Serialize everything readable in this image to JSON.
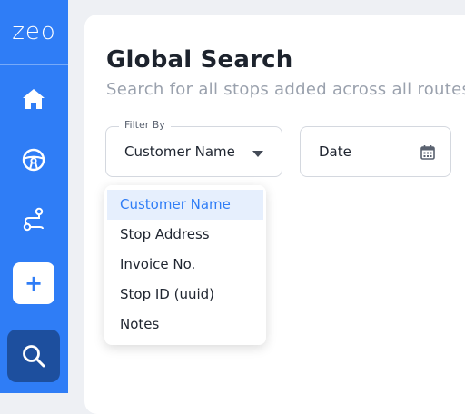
{
  "app": {
    "logo": "zeo"
  },
  "sidebar": {
    "items": [
      {
        "name": "home",
        "icon": "home-icon"
      },
      {
        "name": "steering",
        "icon": "steering-wheel-icon"
      },
      {
        "name": "routes",
        "icon": "route-icon"
      },
      {
        "name": "add",
        "icon": "plus-icon",
        "label": "+"
      },
      {
        "name": "search",
        "icon": "search-icon",
        "active": true
      }
    ],
    "color": "#2f7df6"
  },
  "main": {
    "title": "Global Search",
    "subtitle": "Search for all stops added across all routes"
  },
  "filter": {
    "legend": "Filter By",
    "selected": "Customer Name",
    "options": [
      "Customer Name",
      "Stop Address",
      "Invoice No.",
      "Stop ID (uuid)",
      "Notes"
    ]
  },
  "date": {
    "value": "Date"
  }
}
